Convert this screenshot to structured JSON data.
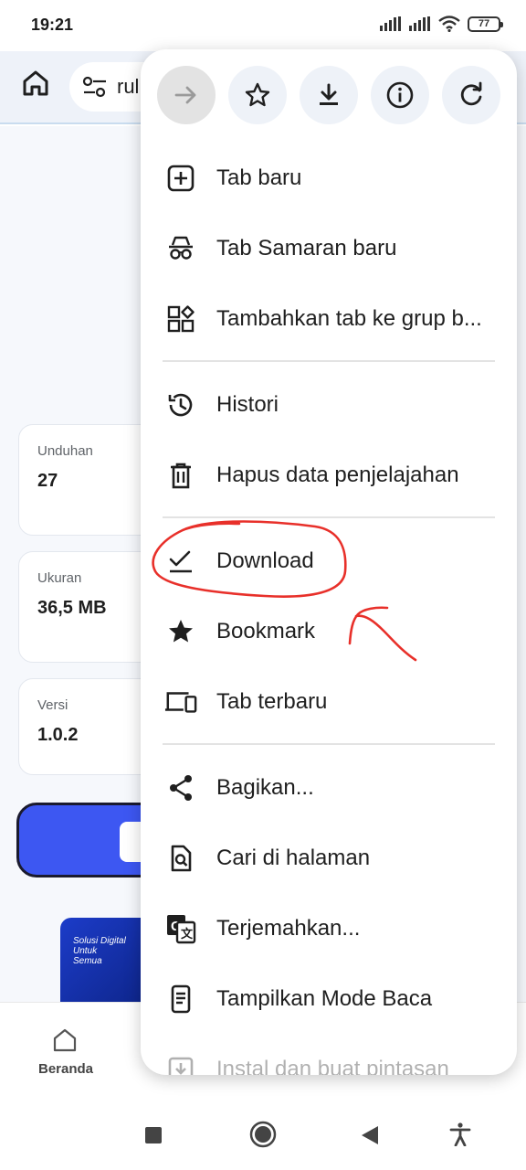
{
  "status": {
    "time": "19:21",
    "battery": "77"
  },
  "toolbar": {
    "url_text": "rul"
  },
  "page": {
    "cards": [
      {
        "label": "Unduhan",
        "value": "27"
      },
      {
        "label": "Ukuran",
        "value": "36,5 MB"
      },
      {
        "label": "Versi",
        "value": "1.0.2"
      }
    ],
    "promo_text": "Solusi Digital Untuk Semua"
  },
  "appnav": {
    "home_label": "Beranda"
  },
  "menu": {
    "top_icons": [
      "forward-icon",
      "star-outline-icon",
      "download-icon",
      "info-icon",
      "refresh-icon"
    ],
    "items": [
      {
        "label": "Tab baru",
        "icon": "add-box-icon"
      },
      {
        "label": "Tab Samaran baru",
        "icon": "incognito-icon"
      },
      {
        "label": "Tambahkan tab ke grup b...",
        "icon": "tab-group-icon"
      },
      {
        "label": "Histori",
        "icon": "history-icon"
      },
      {
        "label": "Hapus data penjelajahan",
        "icon": "trash-icon"
      },
      {
        "label": "Download",
        "icon": "download-done-icon"
      },
      {
        "label": "Bookmark",
        "icon": "star-filled-icon"
      },
      {
        "label": "Tab terbaru",
        "icon": "devices-icon"
      },
      {
        "label": "Bagikan...",
        "icon": "share-icon"
      },
      {
        "label": "Cari di halaman",
        "icon": "find-in-page-icon"
      },
      {
        "label": "Terjemahkan...",
        "icon": "translate-icon"
      },
      {
        "label": "Tampilkan Mode Baca",
        "icon": "reader-mode-icon"
      },
      {
        "label": "Instal dan buat pintasan",
        "icon": "install-icon"
      }
    ]
  },
  "colors": {
    "annotation": "#e8302a",
    "accent": "#3d57f2",
    "toolbar_bg": "#eef2f9"
  }
}
